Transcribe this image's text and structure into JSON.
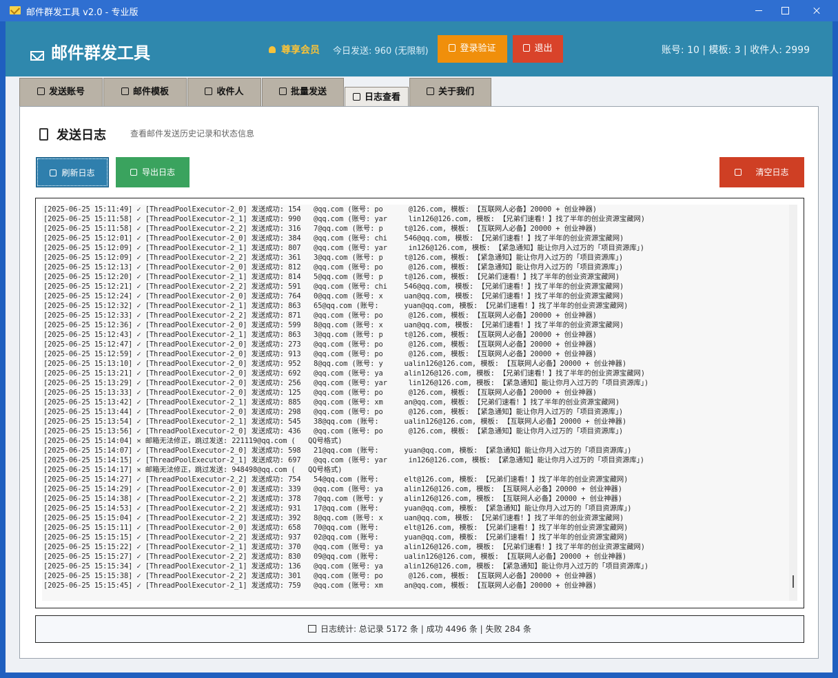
{
  "window": {
    "title": "邮件群发工具 v2.0 - 专业版",
    "icon": "envelope-icon"
  },
  "header": {
    "brand": "邮件群发工具",
    "vip_label": "尊享会员",
    "today_sent": "今日发送: 960 (无限制)",
    "login_button": "登录验证",
    "exit_button": "退出",
    "stats": "账号: 10 | 模板: 3 | 收件人: 2999",
    "colors": {
      "header_bg": "#2f88ad",
      "login": "#f08f0b",
      "exit": "#d9432a",
      "vip": "#f7c23a"
    }
  },
  "tabs": [
    {
      "label": "发送账号",
      "icon": "lock-icon"
    },
    {
      "label": "邮件模板",
      "icon": "edit-icon"
    },
    {
      "label": "收件人",
      "icon": "users-icon"
    },
    {
      "label": "批量发送",
      "icon": "rocket-icon"
    },
    {
      "label": "日志查看",
      "icon": "log-icon",
      "active": true
    },
    {
      "label": "关于我们",
      "icon": "info-icon"
    }
  ],
  "panel": {
    "title": "发送日志",
    "subtitle": "查看邮件发送历史记录和状态信息",
    "refresh_button": "刷新日志",
    "export_button": "导出日志",
    "clear_button": "清空日志"
  },
  "log_lines": [
    "[2025-06-25 15:11:49] ✓ [ThreadPoolExecutor-2_0] 发送成功: 154   @qq.com (账号: po      @126.com, 模板: 【互联网人必备】20000 + 创业神器)",
    "[2025-06-25 15:11:58] ✓ [ThreadPoolExecutor-2_1] 发送成功: 990   @qq.com (账号: yar     lin126@126.com, 模板: 【兄弟们速看！】找了半年的创业资源宝藏网)",
    "[2025-06-25 15:11:58] ✓ [ThreadPoolExecutor-2_2] 发送成功: 316   7@qq.com (账号: p     t@126.com, 模板: 【互联网人必备】20000 + 创业神器)",
    "[2025-06-25 15:12:01] ✓ [ThreadPoolExecutor-2_0] 发送成功: 384   @qq.com (账号: chi    546@qq.com, 模板: 【兄弟们速看！】找了半年的创业资源宝藏网)",
    "[2025-06-25 15:12:09] ✓ [ThreadPoolExecutor-2_1] 发送成功: 807   @qq.com (账号: yar     in126@126.com, 模板: 【紧急通知】能让你月入过万的「项目资源库」)",
    "[2025-06-25 15:12:09] ✓ [ThreadPoolExecutor-2_2] 发送成功: 361   3@qq.com (账号: p     t@126.com, 模板: 【紧急通知】能让你月入过万的「项目资源库」)",
    "[2025-06-25 15:12:13] ✓ [ThreadPoolExecutor-2_0] 发送成功: 812   @qq.com (账号: po      @126.com, 模板: 【紧急通知】能让你月入过万的「项目资源库」)",
    "[2025-06-25 15:12:20] ✓ [ThreadPoolExecutor-2_1] 发送成功: 814   5@qq.com (账号: p     t@126.com, 模板: 【兄弟们速看！】找了半年的创业资源宝藏网)",
    "[2025-06-25 15:12:21] ✓ [ThreadPoolExecutor-2_2] 发送成功: 591   @qq.com (账号: chi    546@qq.com, 模板: 【兄弟们速看！】找了半年的创业资源宝藏网)",
    "[2025-06-25 15:12:24] ✓ [ThreadPoolExecutor-2_0] 发送成功: 764   0@qq.com (账号: x     uan@qq.com, 模板: 【兄弟们速看！】找了半年的创业资源宝藏网)",
    "[2025-06-25 15:12:32] ✓ [ThreadPoolExecutor-2_1] 发送成功: 863   65@qq.com (账号:      yuan@qq.com, 模板: 【兄弟们速看！】找了半年的创业资源宝藏网)",
    "[2025-06-25 15:12:33] ✓ [ThreadPoolExecutor-2_2] 发送成功: 871   @qq.com (账号: po      @126.com, 模板: 【互联网人必备】20000 + 创业神器)",
    "[2025-06-25 15:12:36] ✓ [ThreadPoolExecutor-2_0] 发送成功: 599   8@qq.com (账号: x     uan@qq.com, 模板: 【兄弟们速看！】找了半年的创业资源宝藏网)",
    "[2025-06-25 15:12:43] ✓ [ThreadPoolExecutor-2_1] 发送成功: 863   3@qq.com (账号: p     t@126.com, 模板: 【互联网人必备】20000 + 创业神器)",
    "[2025-06-25 15:12:47] ✓ [ThreadPoolExecutor-2_0] 发送成功: 273   @qq.com (账号: po      @126.com, 模板: 【互联网人必备】20000 + 创业神器)",
    "[2025-06-25 15:12:59] ✓ [ThreadPoolExecutor-2_0] 发送成功: 913   @qq.com (账号: po      @126.com, 模板: 【互联网人必备】20000 + 创业神器)",
    "[2025-06-25 15:13:10] ✓ [ThreadPoolExecutor-2_0] 发送成功: 952   8@qq.com (账号: y     ualin126@126.com, 模板: 【互联网人必备】20000 + 创业神器)",
    "[2025-06-25 15:13:21] ✓ [ThreadPoolExecutor-2_0] 发送成功: 692   @qq.com (账号: ya     alin126@126.com, 模板: 【兄弟们速看！】找了半年的创业资源宝藏网)",
    "[2025-06-25 15:13:29] ✓ [ThreadPoolExecutor-2_0] 发送成功: 256   @qq.com (账号: yar     lin126@126.com, 模板: 【紧急通知】能让你月入过万的「项目资源库」)",
    "[2025-06-25 15:13:33] ✓ [ThreadPoolExecutor-2_0] 发送成功: 125   @qq.com (账号: po      @126.com, 模板: 【互联网人必备】20000 + 创业神器)",
    "[2025-06-25 15:13:42] ✓ [ThreadPoolExecutor-2_1] 发送成功: 885   @qq.com (账号: xm     an@qq.com, 模板: 【兄弟们速看！】找了半年的创业资源宝藏网)",
    "[2025-06-25 15:13:44] ✓ [ThreadPoolExecutor-2_0] 发送成功: 298   @qq.com (账号: po      @126.com, 模板: 【紧急通知】能让你月入过万的「项目资源库」)",
    "[2025-06-25 15:13:54] ✓ [ThreadPoolExecutor-2_1] 发送成功: 545   38@qq.com (账号:      ualin126@126.com, 模板: 【互联网人必备】20000 + 创业神器)",
    "[2025-06-25 15:13:56] ✓ [ThreadPoolExecutor-2_0] 发送成功: 436   @qq.com (账号: po      @126.com, 模板: 【紧急通知】能让你月入过万的「项目资源库」)",
    "[2025-06-25 15:14:04] ✕ 邮箱无法修正，跳过发送: 221119@qq.com (   QQ号格式)",
    "[2025-06-25 15:14:07] ✓ [ThreadPoolExecutor-2_0] 发送成功: 598   21@qq.com (账号:      yuan@qq.com, 模板: 【紧急通知】能让你月入过万的「项目资源库」)",
    "[2025-06-25 15:14:15] ✓ [ThreadPoolExecutor-2_1] 发送成功: 697   @qq.com (账号: yar     in126@126.com, 模板: 【紧急通知】能让你月入过万的「项目资源库」)",
    "[2025-06-25 15:14:17] ✕ 邮箱无法修正，跳过发送: 948498@qq.com (   QQ号格式)",
    "[2025-06-25 15:14:27] ✓ [ThreadPoolExecutor-2_2] 发送成功: 754   54@qq.com (账号:      elt@126.com, 模板: 【兄弟们速看！】找了半年的创业资源宝藏网)",
    "[2025-06-25 15:14:29] ✓ [ThreadPoolExecutor-2_0] 发送成功: 339   @qq.com (账号: ya     alin126@126.com, 模板: 【互联网人必备】20000 + 创业神器)",
    "[2025-06-25 15:14:38] ✓ [ThreadPoolExecutor-2_2] 发送成功: 378   7@qq.com (账号: y     alin126@126.com, 模板: 【互联网人必备】20000 + 创业神器)",
    "[2025-06-25 15:14:53] ✓ [ThreadPoolExecutor-2_2] 发送成功: 931   17@qq.com (账号:      yuan@qq.com, 模板: 【紧急通知】能让你月入过万的「项目资源库」)",
    "[2025-06-25 15:15:04] ✓ [ThreadPoolExecutor-2_2] 发送成功: 392   8@qq.com (账号: x     uan@qq.com, 模板: 【兄弟们速看！】找了半年的创业资源宝藏网)",
    "[2025-06-25 15:15:11] ✓ [ThreadPoolExecutor-2_0] 发送成功: 658   70@qq.com (账号:      elt@126.com, 模板: 【兄弟们速看！】找了半年的创业资源宝藏网)",
    "[2025-06-25 15:15:15] ✓ [ThreadPoolExecutor-2_2] 发送成功: 937   02@qq.com (账号:      yuan@qq.com, 模板: 【兄弟们速看！】找了半年的创业资源宝藏网)",
    "[2025-06-25 15:15:22] ✓ [ThreadPoolExecutor-2_1] 发送成功: 370   @qq.com (账号: ya     alin126@126.com, 模板: 【兄弟们速看！】找了半年的创业资源宝藏网)",
    "[2025-06-25 15:15:27] ✓ [ThreadPoolExecutor-2_2] 发送成功: 830   09@qq.com (账号:      ualin126@126.com, 模板: 【互联网人必备】20000 + 创业神器)",
    "[2025-06-25 15:15:34] ✓ [ThreadPoolExecutor-2_1] 发送成功: 136   @qq.com (账号: ya     alin126@126.com, 模板: 【紧急通知】能让你月入过万的「项目资源库」)",
    "[2025-06-25 15:15:38] ✓ [ThreadPoolExecutor-2_2] 发送成功: 301   @qq.com (账号: po      @126.com, 模板: 【互联网人必备】20000 + 创业神器)",
    "[2025-06-25 15:15:45] ✓ [ThreadPoolExecutor-2_1] 发送成功: 759   @qq.com (账号: xm     an@qq.com, 模板: 【互联网人必备】20000 + 创业神器)"
  ],
  "footer": {
    "stats": "日志统计: 总记录 5172 条 | 成功 4496 条 | 失败 284 条"
  }
}
